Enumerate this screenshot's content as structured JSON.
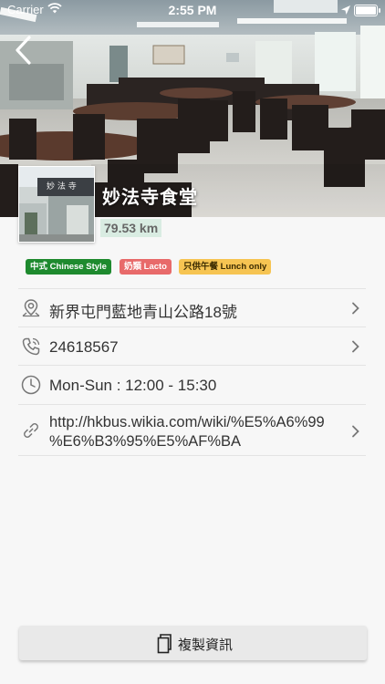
{
  "status_bar": {
    "carrier": "Carrier",
    "time": "2:55 PM"
  },
  "restaurant": {
    "name": "妙法寺食堂",
    "distance": "79.53 km",
    "thumbnail_sign": "妙 法 寺"
  },
  "tags": [
    {
      "label": "中式 Chinese Style",
      "bg": "#1e8a2e",
      "color": "#ffffff"
    },
    {
      "label": "奶類 Lacto",
      "bg": "#e86a6a",
      "color": "#ffffff"
    },
    {
      "label": "只供午餐 Lunch only",
      "bg": "#f6c452",
      "color": "#3a2a00"
    }
  ],
  "info": {
    "address": "新界屯門藍地青山公路18號",
    "phone": "24618567",
    "hours": "Mon-Sun : 12:00 - 15:30",
    "url_line1": "http://hkbus.wikia.com/wiki/%E5%A6%99",
    "url_line2": "%E6%B3%95%E5%AF%BA"
  },
  "copy_button": {
    "label": "複製資訊",
    "icon": "copy-icon"
  },
  "icons": {
    "back": "chevron-left-icon",
    "address": "location-pin-icon",
    "phone": "phone-icon",
    "hours": "clock-icon",
    "url": "link-icon"
  },
  "colors": {
    "accent_green": "#1e8a2e",
    "distance_bg": "#d9ece2"
  }
}
